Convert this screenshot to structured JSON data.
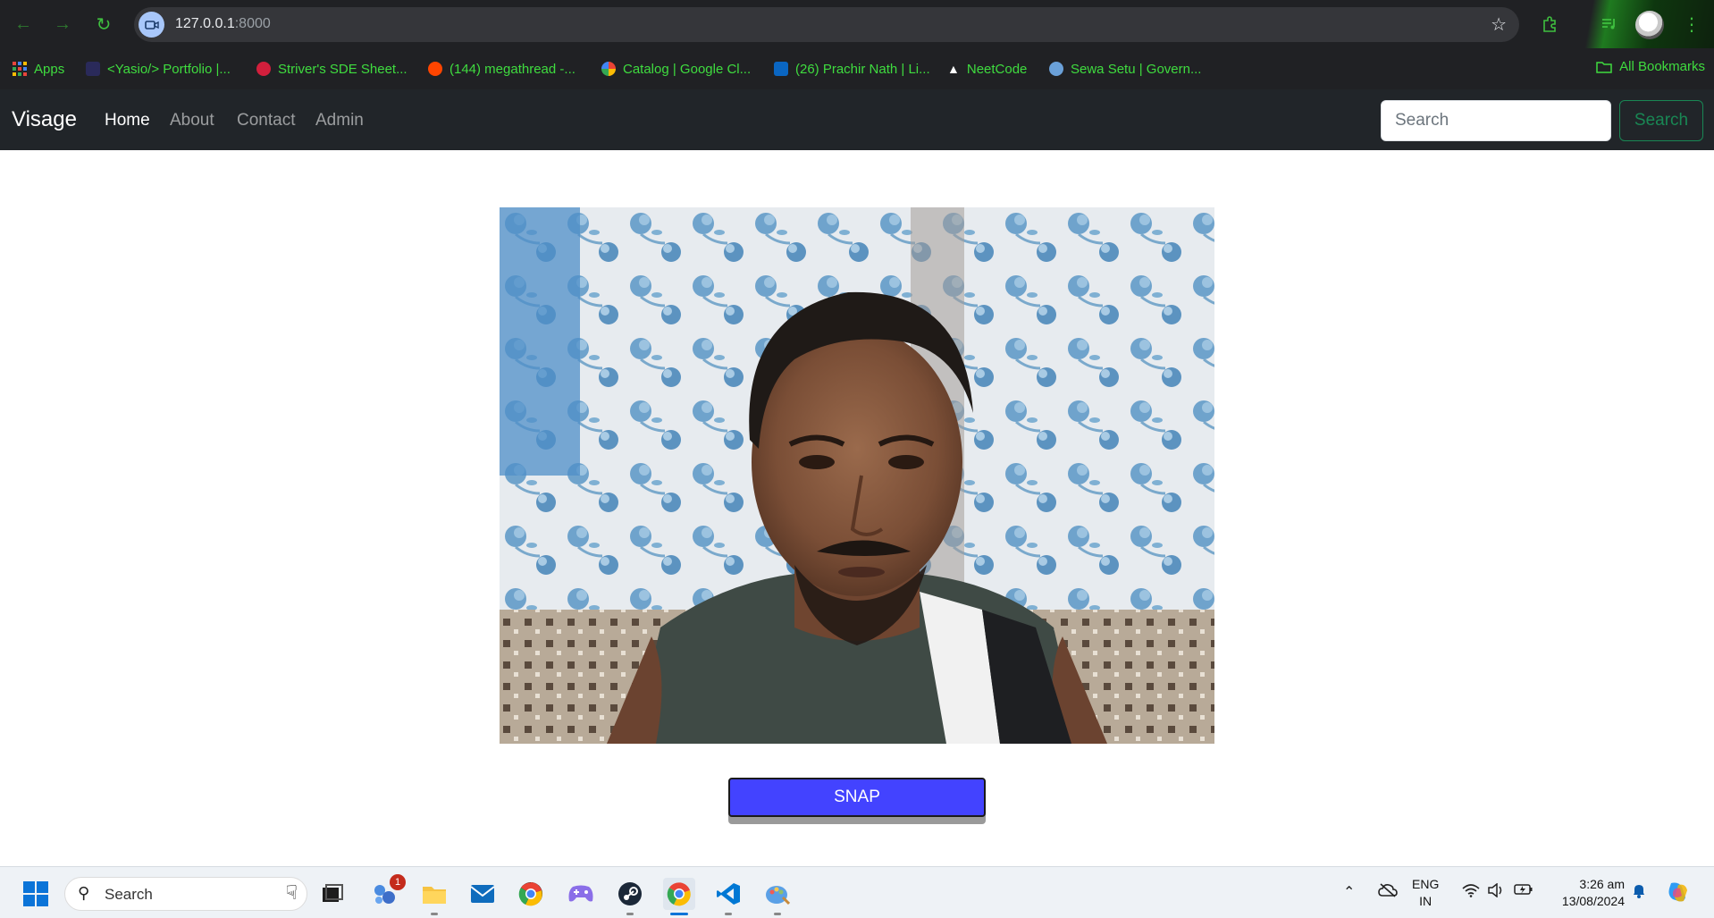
{
  "browser": {
    "url_host": "127.0.0.1",
    "url_port": ":8000",
    "bookmarks": [
      {
        "label": "Apps",
        "color": "#e8453c"
      },
      {
        "label": "<Yasio/> Portfolio |...",
        "color": "#2a2a5a"
      },
      {
        "label": "Striver's SDE Sheet...",
        "color": "#d21f3c"
      },
      {
        "label": "(144) megathread -...",
        "color": "#ff4500"
      },
      {
        "label": "Catalog | Google Cl...",
        "color": "#4285f4"
      },
      {
        "label": "(26) Prachir Nath | Li...",
        "color": "#0a66c2"
      },
      {
        "label": "NeetCode",
        "color": "#ffffff"
      },
      {
        "label": "Sewa Setu | Govern...",
        "color": "#6aa0d8"
      }
    ],
    "all_bookmarks": "All Bookmarks"
  },
  "site": {
    "brand": "Visage",
    "nav": [
      {
        "label": "Home",
        "active": true
      },
      {
        "label": "About",
        "active": false
      },
      {
        "label": "Contact",
        "active": false
      },
      {
        "label": "Admin",
        "active": false
      }
    ],
    "search_placeholder": "Search",
    "search_button": "Search",
    "snap_button": "SNAP"
  },
  "taskbar": {
    "search_placeholder": "Search",
    "notification_badge": "1",
    "lang_top": "ENG",
    "lang_bottom": "IN",
    "time": "3:26 am",
    "date": "13/08/2024"
  }
}
